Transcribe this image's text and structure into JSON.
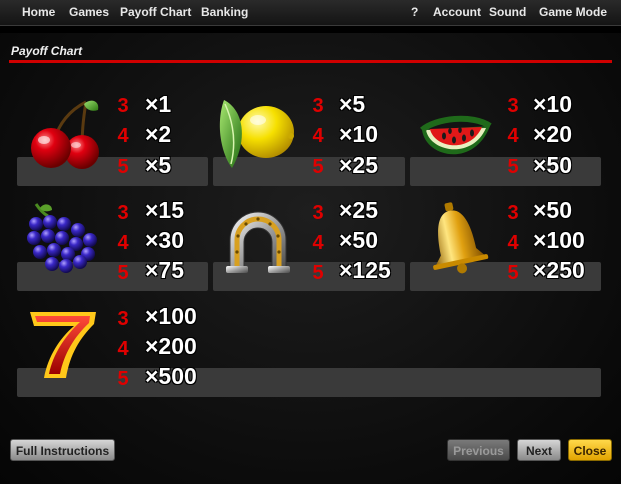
{
  "menu": {
    "left": [
      "Home",
      "Games",
      "Payoff Chart",
      "Banking"
    ],
    "right": [
      "?",
      "Account",
      "Sound",
      "Game Mode"
    ]
  },
  "panel": {
    "title": "Payoff Chart"
  },
  "symbols": [
    {
      "icon": "cherries-icon",
      "rows": [
        {
          "count": "3",
          "pay": "×1"
        },
        {
          "count": "4",
          "pay": "×2"
        },
        {
          "count": "5",
          "pay": "×5"
        }
      ]
    },
    {
      "icon": "lemon-icon",
      "rows": [
        {
          "count": "3",
          "pay": "×5"
        },
        {
          "count": "4",
          "pay": "×10"
        },
        {
          "count": "5",
          "pay": "×25"
        }
      ]
    },
    {
      "icon": "watermelon-icon",
      "rows": [
        {
          "count": "3",
          "pay": "×10"
        },
        {
          "count": "4",
          "pay": "×20"
        },
        {
          "count": "5",
          "pay": "×50"
        }
      ]
    },
    {
      "icon": "grapes-icon",
      "rows": [
        {
          "count": "3",
          "pay": "×15"
        },
        {
          "count": "4",
          "pay": "×30"
        },
        {
          "count": "5",
          "pay": "×75"
        }
      ]
    },
    {
      "icon": "horseshoe-icon",
      "rows": [
        {
          "count": "3",
          "pay": "×25"
        },
        {
          "count": "4",
          "pay": "×50"
        },
        {
          "count": "5",
          "pay": "×125"
        }
      ]
    },
    {
      "icon": "bell-icon",
      "rows": [
        {
          "count": "3",
          "pay": "×50"
        },
        {
          "count": "4",
          "pay": "×100"
        },
        {
          "count": "5",
          "pay": "×250"
        }
      ]
    },
    {
      "icon": "seven-icon",
      "rows": [
        {
          "count": "3",
          "pay": "×100"
        },
        {
          "count": "4",
          "pay": "×200"
        },
        {
          "count": "5",
          "pay": "×500"
        }
      ]
    }
  ],
  "buttons": {
    "full_instructions": "Full Instructions",
    "previous": "Previous",
    "next": "Next",
    "close": "Close"
  },
  "colors": {
    "accent_red": "#d00000",
    "count_red": "#e00000",
    "close_yellow": "#ffc21a"
  }
}
